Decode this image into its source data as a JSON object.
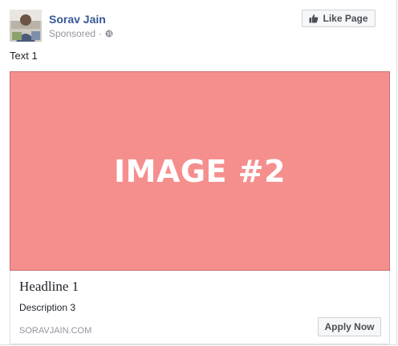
{
  "post": {
    "page_name": "Sorav Jain",
    "sponsored_label": "Sponsored",
    "separator": "·",
    "privacy_icon": "globe-icon",
    "like_button_label": "Like Page",
    "like_button_icon": "thumbs-up-icon",
    "body_text": "Text 1"
  },
  "ad": {
    "image_label": "IMAGE #2",
    "image_color": "#f58f8e",
    "headline": "Headline 1",
    "description": "Description 3",
    "domain": "SORAVJAIN.COM",
    "cta_label": "Apply Now"
  },
  "colors": {
    "link_blue": "#385898",
    "meta_gray": "#90949c",
    "button_bg": "#f6f7f9"
  }
}
